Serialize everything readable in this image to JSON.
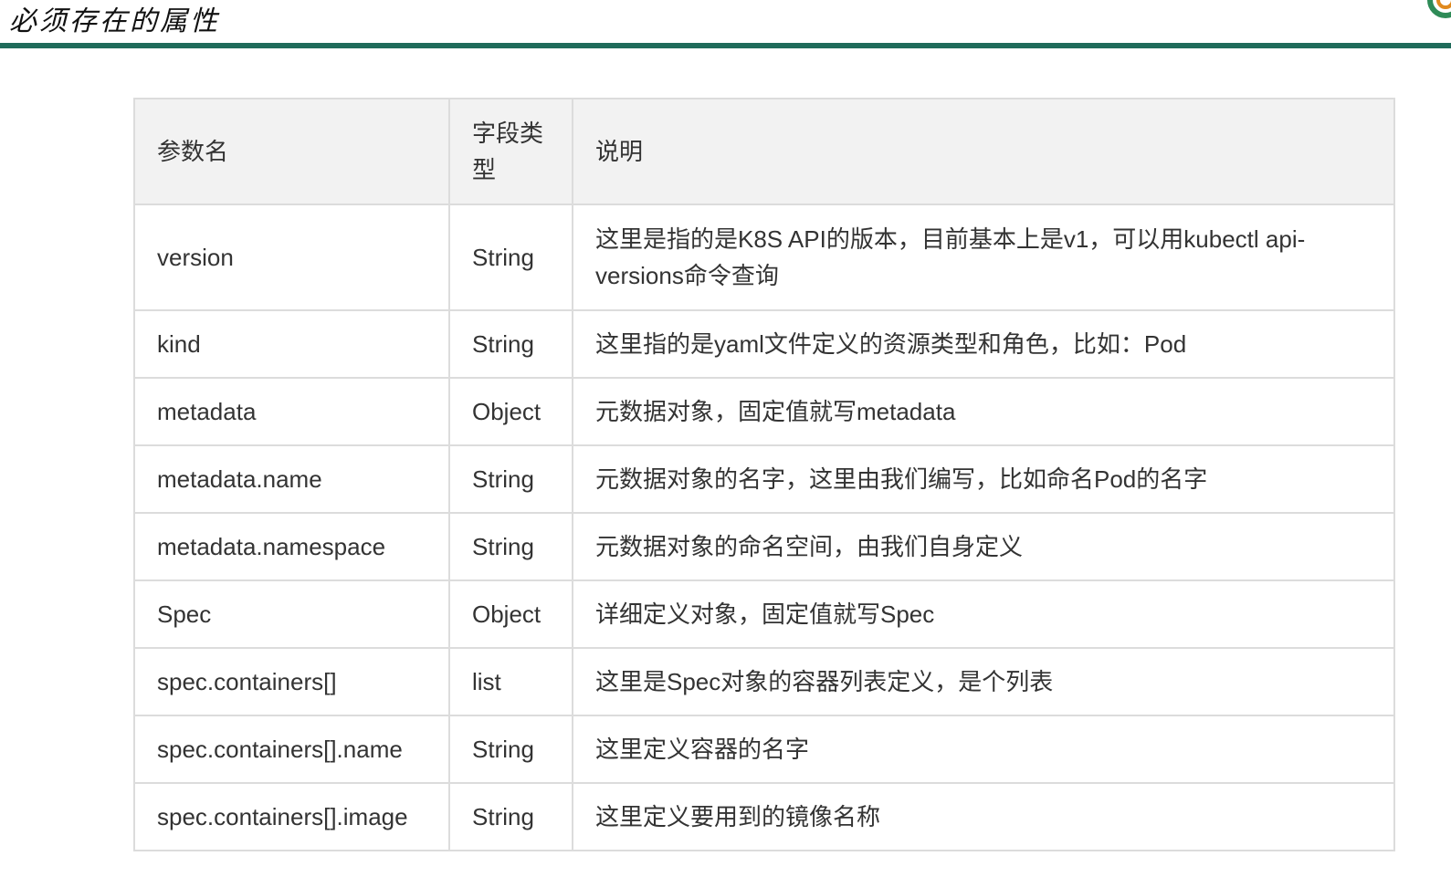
{
  "page": {
    "title": "必须存在的属性"
  },
  "logo": {
    "icon": "circle-logo-icon",
    "colors": [
      "#2e8b57",
      "#e08a1e"
    ]
  },
  "accent_color": "#1f6b5a",
  "table": {
    "headers": {
      "name": "参数名",
      "type": "字段类型",
      "description": "说明"
    },
    "rows": [
      {
        "name": "version",
        "type": "String",
        "description": "这里是指的是K8S API的版本，目前基本上是v1，可以用kubectl api-versions命令查询"
      },
      {
        "name": "kind",
        "type": "String",
        "description": "这里指的是yaml文件定义的资源类型和角色，比如：Pod"
      },
      {
        "name": "metadata",
        "type": "Object",
        "description": "元数据对象，固定值就写metadata"
      },
      {
        "name": "metadata.name",
        "type": "String",
        "description": "元数据对象的名字，这里由我们编写，比如命名Pod的名字"
      },
      {
        "name": "metadata.namespace",
        "type": "String",
        "description": "元数据对象的命名空间，由我们自身定义"
      },
      {
        "name": "Spec",
        "type": "Object",
        "description": "详细定义对象，固定值就写Spec"
      },
      {
        "name": "spec.containers[]",
        "type": "list",
        "description": "这里是Spec对象的容器列表定义，是个列表"
      },
      {
        "name": "spec.containers[].name",
        "type": "String",
        "description": "这里定义容器的名字"
      },
      {
        "name": "spec.containers[].image",
        "type": "String",
        "description": "这里定义要用到的镜像名称"
      }
    ]
  }
}
